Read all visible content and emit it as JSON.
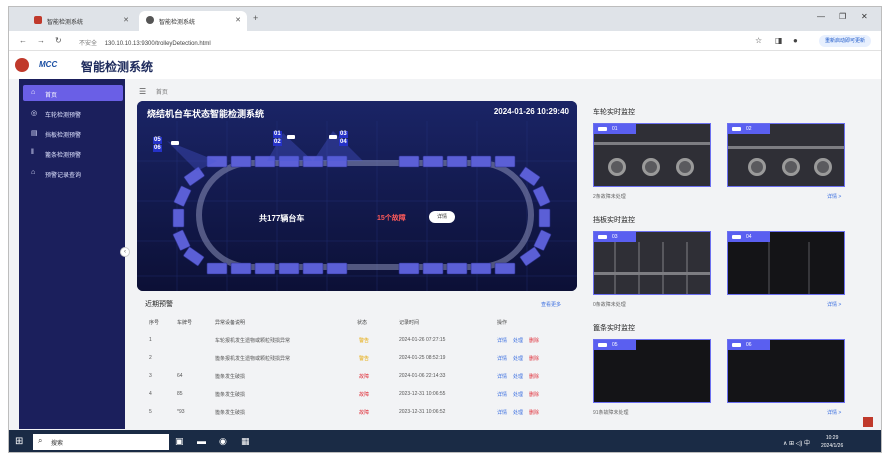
{
  "browser": {
    "tabs": [
      {
        "label": "智能检测系统"
      },
      {
        "label": "智能检测系统"
      }
    ],
    "url_security": "不安全",
    "url": "130.10.10.13:9300/trolleyDetection.html",
    "update_button": "重新启动即可更新"
  },
  "header": {
    "brand": "MCC",
    "title": "智能检测系统"
  },
  "sidebar": {
    "items": [
      {
        "label": "首页",
        "icon": "home-icon"
      },
      {
        "label": "车轮检测预警",
        "icon": "wheel-icon"
      },
      {
        "label": "挡板检测预警",
        "icon": "baffle-icon"
      },
      {
        "label": "篦条检测预警",
        "icon": "grate-icon"
      },
      {
        "label": "预警记录查询",
        "icon": "record-icon"
      }
    ]
  },
  "breadcrumb": {
    "current": "首页"
  },
  "viz": {
    "title": "烧结机台车状态智能检测系统",
    "datetime": "2024-01-26 10:29:40",
    "total_text": "共177辆台车",
    "fault_text": "15个故障",
    "detail_button": "详情",
    "camera_tags": [
      "05",
      "06",
      "01",
      "02",
      "03",
      "04"
    ]
  },
  "alarms": {
    "title": "近期预警",
    "more": "查看更多",
    "columns": [
      "序号",
      "车牌号",
      "异常设备说明",
      "状态",
      "记录时间",
      "操作"
    ],
    "actions": [
      "详情",
      "处理",
      "删除"
    ],
    "rows": [
      {
        "no": "1",
        "plate": "",
        "desc": "车轮报机发生遗物或颗粒残损异常",
        "status": "警告",
        "status_type": "warn",
        "time": "2024-01-26 07:27:15"
      },
      {
        "no": "2",
        "plate": "",
        "desc": "篦条报机发生遗物或颗粒残损异常",
        "status": "警告",
        "status_type": "warn",
        "time": "2024-01-25 08:52:19"
      },
      {
        "no": "3",
        "plate": "64",
        "desc": "篦条发生破损",
        "status": "故障",
        "status_type": "fault",
        "time": "2024-01-06 22:14:33"
      },
      {
        "no": "4",
        "plate": "85",
        "desc": "篦条发生破损",
        "status": "故障",
        "status_type": "fault",
        "time": "2023-12-31 10:06:55"
      },
      {
        "no": "5",
        "plate": "*93",
        "desc": "篦条发生破损",
        "status": "故障",
        "status_type": "fault",
        "time": "2023-12-31 10:06:52"
      }
    ]
  },
  "monitors": [
    {
      "title": "车轮实时监控",
      "cams": [
        "01",
        "02"
      ],
      "footer": "2条故障未处理",
      "more": "详情 >"
    },
    {
      "title": "挡板实时监控",
      "cams": [
        "03",
        "04"
      ],
      "footer": "0条故障未处理",
      "more": "详情 >"
    },
    {
      "title": "篦条实时监控",
      "cams": [
        "05",
        "06"
      ],
      "footer": "91条故障未处理",
      "more": "详情 >"
    }
  ],
  "taskbar": {
    "search": "搜索",
    "tray": "∧ ⊞ ◁) 中",
    "time": "10:29",
    "date": "2024/1/26"
  }
}
